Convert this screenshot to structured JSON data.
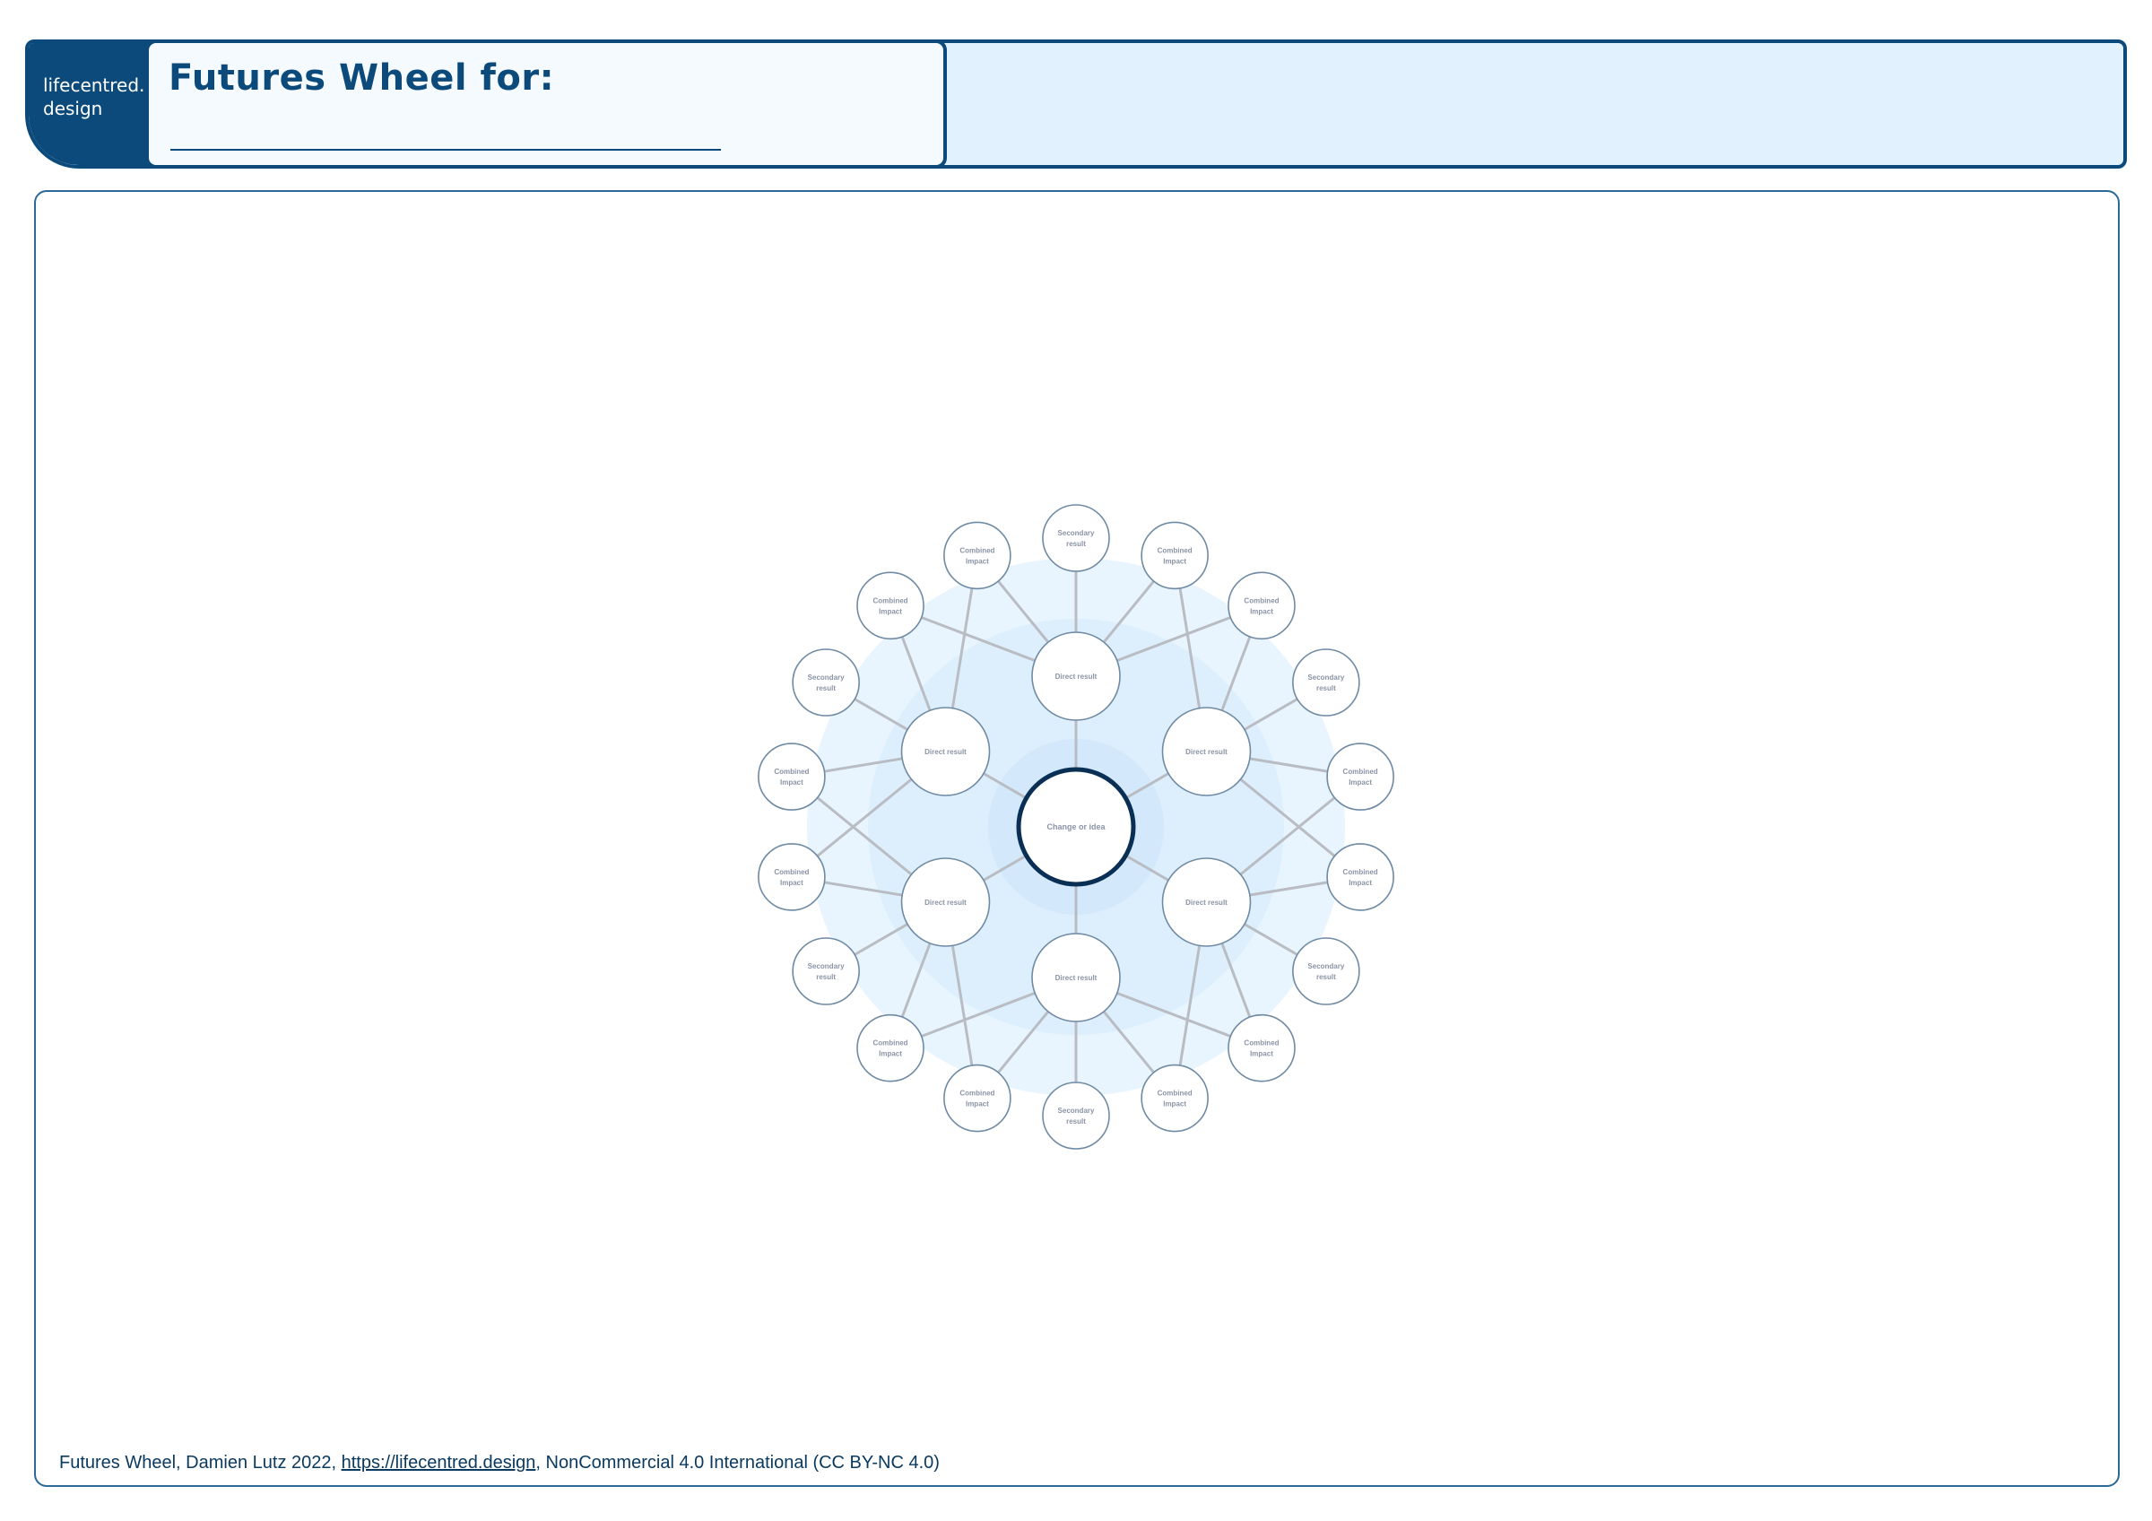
{
  "header": {
    "logo_text": "lifecentred.\ndesign",
    "title": "Futures Wheel for:",
    "title_value": ""
  },
  "wheel": {
    "center_label": "Change or idea",
    "direct": [
      "Direct result",
      "Direct result",
      "Direct result",
      "Direct result",
      "Direct result",
      "Direct result"
    ],
    "outer": [
      {
        "label": "Secondary result",
        "kind": "secondary"
      },
      {
        "label": "Combined Impact",
        "kind": "combined"
      },
      {
        "label": "Combined Impact",
        "kind": "combined"
      },
      {
        "label": "Secondary result",
        "kind": "secondary"
      },
      {
        "label": "Combined Impact",
        "kind": "combined"
      },
      {
        "label": "Combined Impact",
        "kind": "combined"
      },
      {
        "label": "Secondary result",
        "kind": "secondary"
      },
      {
        "label": "Combined Impact",
        "kind": "combined"
      },
      {
        "label": "Combined Impact",
        "kind": "combined"
      },
      {
        "label": "Secondary result",
        "kind": "secondary"
      },
      {
        "label": "Combined Impact",
        "kind": "combined"
      },
      {
        "label": "Combined Impact",
        "kind": "combined"
      },
      {
        "label": "Secondary result",
        "kind": "secondary"
      },
      {
        "label": "Combined Impact",
        "kind": "combined"
      },
      {
        "label": "Combined Impact",
        "kind": "combined"
      },
      {
        "label": "Secondary result",
        "kind": "secondary"
      },
      {
        "label": "Combined Impact",
        "kind": "combined"
      },
      {
        "label": "Combined Impact",
        "kind": "combined"
      }
    ],
    "colors": {
      "ring_outer": "#e8f4fe",
      "ring_mid": "#ddeffd",
      "ring_inner": "#d3e9fb",
      "node_fill": "#ffffff",
      "node_stroke": "#6f8aa3",
      "center_stroke": "#0a2f55",
      "link": "#b9bdc3"
    }
  },
  "footer": {
    "prefix": "Futures Wheel, Damien Lutz 2022, ",
    "link": "https://lifecentred.design",
    "suffix": ", NonCommercial 4.0 International (CC BY-NC 4.0)"
  }
}
